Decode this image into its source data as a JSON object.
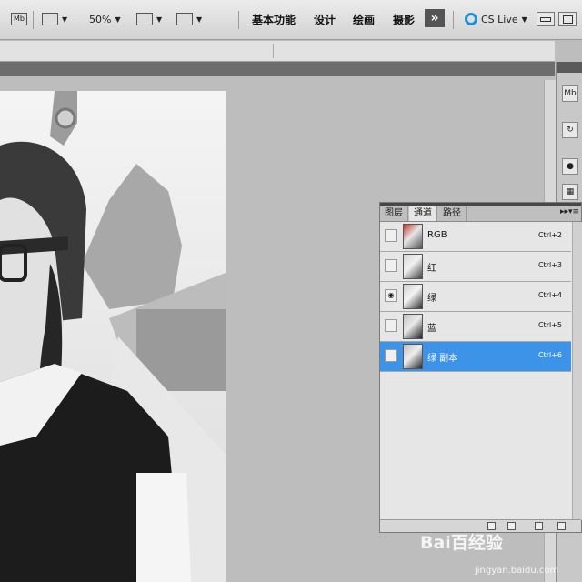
{
  "topbar": {
    "mb_label": "Mb",
    "zoom": "50%",
    "workspaces": [
      "基本功能",
      "设计",
      "绘画",
      "摄影"
    ],
    "more_label": "»",
    "cslive": "CS Live"
  },
  "dock": {
    "mb_label": "Mb"
  },
  "panel": {
    "tabs": [
      "图层",
      "通道",
      "路径"
    ],
    "channels": [
      {
        "name": "RGB",
        "shortcut": "Ctrl+2",
        "visible": false,
        "selected": false
      },
      {
        "name": "红",
        "shortcut": "Ctrl+3",
        "visible": false,
        "selected": false
      },
      {
        "name": "绿",
        "shortcut": "Ctrl+4",
        "visible": true,
        "selected": false
      },
      {
        "name": "蓝",
        "shortcut": "Ctrl+5",
        "visible": false,
        "selected": false
      },
      {
        "name": "绿 副本",
        "shortcut": "Ctrl+6",
        "visible": false,
        "selected": true
      }
    ]
  },
  "watermark": {
    "main": "Bai百经验",
    "sub": "jingyan.baidu.com"
  },
  "colors": {
    "selected_row": "#3d93e8",
    "thumb_red": "#c0392b"
  }
}
